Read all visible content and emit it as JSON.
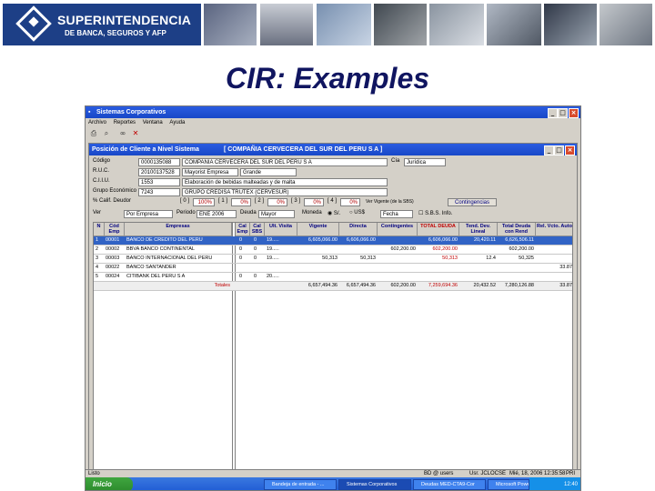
{
  "banner": {
    "logo_line1": "SUPERINTENDENCIA",
    "logo_line2": "DE BANCA, SEGUROS Y AFP"
  },
  "slide_title": "CIR: Examples",
  "app": {
    "title": "Sistemas Corporativos",
    "menu": [
      "Archivo",
      "Reportes",
      "Ventana",
      "Ayuda"
    ]
  },
  "form": {
    "title": "Posición de Cliente a Nivel Sistema",
    "company_title": "[ COMPAÑIA CERVECERA DEL SUR DEL PERU S A ]",
    "codigo": {
      "label": "Código",
      "value": "0000135088",
      "name": "COMPAÑIA CERVECERA DEL SUR DEL PERU S A"
    },
    "cia": {
      "label": "Cía",
      "value": "Jurídica"
    },
    "ruc": {
      "label": "R.U.C.",
      "value": "20100137528",
      "sector": "Mayorist Empresa",
      "size": "Grande"
    },
    "ciiu": {
      "label": "C.I.I.U.",
      "value": "1553",
      "desc": "Elaboración de bebidas malteadas y de malta"
    },
    "grupo": {
      "label": "Grupo Económico",
      "value": "7243",
      "desc": "GRUPO CREDISA TRUTEX (CERVESUR)"
    },
    "calificacion": {
      "label": "% Calif. Deudor",
      "items": [
        {
          "label": "[ 0 ]",
          "value": "100%"
        },
        {
          "label": "[ 1 ]",
          "value": "0%"
        },
        {
          "label": "[ 2 ]",
          "value": "0%"
        },
        {
          "label": "[ 3 ]",
          "value": "0%"
        },
        {
          "label": "[ 4 ]",
          "value": "0%"
        }
      ],
      "note": "Ver Vigente (de la SBS)",
      "contingency_button": "Contingencias"
    },
    "filters": {
      "ver_label": "Ver",
      "ver_value": "Por Empresa",
      "periodo_label": "Periodo",
      "periodo_value": "ENE 2006",
      "deuda_label": "Deuda",
      "deuda_value": "Mayor",
      "moneda_label": "Moneda",
      "moneda_options": [
        "S/.",
        "US$"
      ],
      "extra_value": "Fecha",
      "info_label": "S.B.S. Info."
    }
  },
  "grid": {
    "columns": [
      "N",
      "Cód Emp",
      "Empresas",
      "Cal Emp",
      "Cal SBS",
      "Ult. Visita",
      "Vigente",
      "Directa",
      "Contingentes",
      "TOTAL DEUDA",
      "Tend. Dev. Lineal",
      "Total Deuda con Rend",
      "Rel. Vcto. Auto"
    ],
    "rows": [
      {
        "n": "1",
        "cod": "00001",
        "empresa": "BANCO DE CREDITO DEL PERU",
        "cal_emp": "0",
        "cal_sbs": "0",
        "visita": "19.....",
        "vigente": "6,605,066.00",
        "directa": "6,606,066.00",
        "contingentes": "",
        "total": "6,606,066.00",
        "tend": "20,420.11",
        "total_rend": "6,626,506.11",
        "rel": ""
      },
      {
        "n": "2",
        "cod": "00002",
        "empresa": "BBVA BANCO CONTINENTAL",
        "cal_emp": "0",
        "cal_sbs": "0",
        "visita": "19.....",
        "vigente": "",
        "directa": "",
        "contingentes": "602,200.00",
        "total": "602,200.00",
        "tend": "",
        "total_rend": "602,200.00",
        "rel": ""
      },
      {
        "n": "3",
        "cod": "00003",
        "empresa": "BANCO INTERNACIONAL DEL PERU",
        "cal_emp": "0",
        "cal_sbs": "0",
        "visita": "19.....",
        "vigente": "50,313",
        "directa": "50,313",
        "contingentes": "",
        "total": "50,313",
        "tend": "12.4",
        "total_rend": "50,325",
        "rel": ""
      },
      {
        "n": "4",
        "cod": "00022",
        "empresa": "BANCO SANTANDER",
        "cal_emp": "",
        "cal_sbs": "",
        "visita": "",
        "vigente": "",
        "directa": "",
        "contingentes": "",
        "total": "",
        "tend": "",
        "total_rend": "",
        "rel": "33.87"
      },
      {
        "n": "5",
        "cod": "00024",
        "empresa": "CITIBANK DEL PERU S A",
        "cal_emp": "0",
        "cal_sbs": "0",
        "visita": "20.....",
        "vigente": "",
        "directa": "",
        "contingentes": "",
        "total": "",
        "tend": "",
        "total_rend": "",
        "rel": ""
      }
    ],
    "totals": {
      "label": "Totales",
      "vigente": "6,657,494.36",
      "directa": "6,657,494.36",
      "contingentes": "602,200.00",
      "total": "7,259,694.36",
      "tend": "20,432.52",
      "total_rend": "7,280,126.88",
      "rel": "33.87"
    }
  },
  "status": {
    "left": "Listo",
    "user": "BD @ users",
    "host": "Usr. JCLOCSE",
    "date": "Mié, 18, 2006 12:35:58",
    "mode": "PRI"
  },
  "taskbar": {
    "start": "Inicio",
    "tasks": [
      "Bandeja de entrada - ...",
      "Sistemas Corporativos",
      "Deudas MED-CTA9-Cor",
      "Microsoft PowerPoint ..."
    ],
    "clock": "12:40"
  }
}
